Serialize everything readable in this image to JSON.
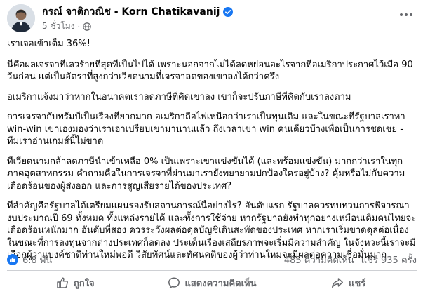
{
  "post": {
    "author": {
      "name": "กรณ์ จาติกวณิช - Korn Chatikavanij",
      "verified": true
    },
    "timestamp": "5 ชั่วโมง",
    "audience_icon": "globe-icon",
    "paragraphs": [
      "เราเจอเข้าเต็ม 36%!",
      "นี่คือผลเจรจาที่เลวร้ายที่สุดที่เป็นไปได้ เพราะนอกจากไม่ได้ลดหย่อนอะไรจากที่อเมริกาประกาศไว้เมื่อ 90 วันก่อน แต่เป็นอัตราที่สูงกว่าเวียดนามที่เจรจาลดของเขาลงได้กว่าครึ่ง",
      "อเมริกาแจ้งมาว่าหากในอนาคตเราลดภาษีที่คิดเขาลง เขาก็จะปรับภาษีที่คิดกับเราลงตาม",
      "การเจรจากับทรัมป์เป็นเรื่องที่ยากมาก อเมริกาถือไพ่เหนือกว่าเราเป็นทุนเดิม และในขณะที่รัฐบาลเราหา win-win เขาเองมองว่าเราเอาเปรียบเขามานานแล้ว ถึงเวลาเขา win คนเดียวบ้างเพื่อเป็นการชดเชย - ทีมเราอ่านเกมส์นี้ไม่ขาด",
      "ที่เวียดนามกล้าลดภาษีนำเข้าเหลือ 0% เป็นเพราะเขาแข่งขันได้ (และพร้อมแข่งขัน) มากกว่าเราในทุกภาคอุตสาหกรรม คำถามคือในการเจรจาที่ผ่านมาเรายังพยายามปกป้องใครอยู่บ้าง? คุ้มหรือไม่กับความเดือดร้อนของผู้ส่งออก และการสูญเสียรายได้ของประเทศ?",
      "ที่สำคัญคือรัฐบาลได้เตรียมแผนรองรับสถานการณ์นี้อย่างไร? อันดับแรก รัฐบาลควรทบทวนการพิจารณางบประมาณปี 69 ทั้งหมด ทั้งแหล่งรายได้ และทั้งการใช้จ่าย หากรัฐบาลยังทำทุกอย่างเหมือนเดิมคนไทยจะเดือดร้อนหนักมาก อันดับที่สอง ควรระวังผลต่อดุลบัญชีเดินสะพัดของประเทศ หากเราเริ่มขาดดุลต่อเนื่อง ในขณะที่การลงทุนจากต่างประเทศก็ลดลง ประเด็นเรื่องเสถียรภาพจะเริ่มมีความสำคัญ ในจังหวะนี้เราจะมีเลือกผู้ว่าแบงค์ชาติท่านใหม่พอดี วิสัยทัศน์และทัศนคติของผู้ว่าท่านใหม่จะมีผลต่อความเชื่อมั่นมาก"
    ],
    "stats": {
      "reactions": "6.8 พัน",
      "comments": "485 ความคิดเห็น",
      "shares": "แชร์ 935 ครั้ง"
    },
    "actions": {
      "like_label": "ถูกใจ",
      "comment_label": "แสดงความคิดเห็น",
      "share_label": "แชร์"
    }
  },
  "colors": {
    "accent": "#1877f2",
    "secondary_text": "#65676b",
    "divider": "#ced0d4"
  }
}
